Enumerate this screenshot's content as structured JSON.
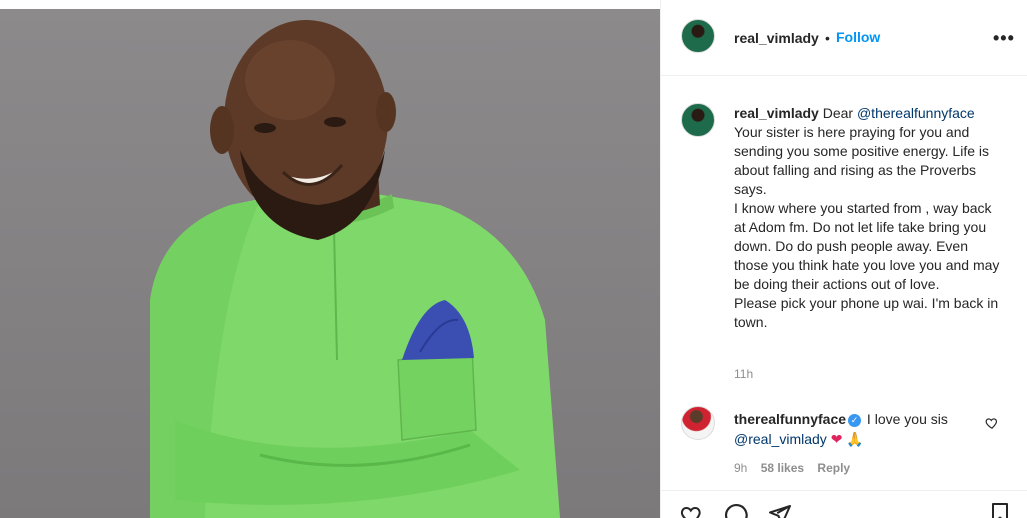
{
  "post": {
    "username": "real_vimlady",
    "separator": "•",
    "follow_label": "Follow",
    "more_label": "•••"
  },
  "caption": {
    "username": "real_vimlady",
    "lead": " Dear ",
    "mention": "@therealfunnyface",
    "body": "\nYour sister is here praying for you and sending you some positive energy. Life is about falling and rising as the Proverbs says.\nI know where you started from , way back at Adom fm. Do not let life take bring you down. Do do push people away. Even those you think hate you love you and may be doing their actions out of love.\nPlease pick your phone up wai. I'm back in town.",
    "time": "11h"
  },
  "comment": {
    "username": "therealfunnyface",
    "verified_icon": "✓",
    "text": " I love you sis ",
    "mention": "@real_vimlady",
    "emoji_heart": "❤",
    "emoji_pray": "🙏",
    "time": "9h",
    "likes": "58 likes",
    "reply_label": "Reply"
  },
  "icons": {
    "like": "heart-icon",
    "comment": "comment-icon",
    "share": "share-icon",
    "save": "bookmark-icon"
  },
  "colors": {
    "accent": "#0095f6",
    "mention": "#00376b",
    "muted": "#8e8e8e",
    "shirt": "#7fd96a",
    "pocket_square": "#3b4fb3"
  }
}
